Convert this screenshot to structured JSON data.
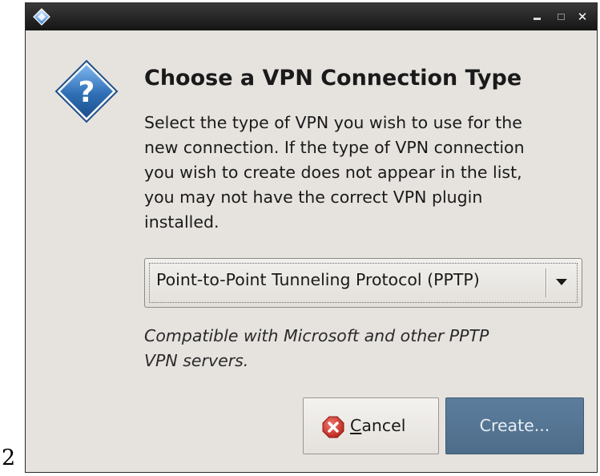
{
  "page": {
    "stray_text": "2"
  },
  "window": {
    "title": "",
    "icon": "diamond-app-icon",
    "controls": {
      "minimize_icon": "minimize-icon",
      "maximize_icon": "maximize-icon",
      "close_icon": "close-icon"
    }
  },
  "dialog": {
    "icon": "question-icon",
    "heading": "Choose a VPN Connection Type",
    "description_lines": [
      "Select the type of VPN you wish to use for the",
      "new connection.  If the type of VPN connection",
      "you wish to create does not appear in the list,",
      "you may not have the correct VPN plugin",
      "installed."
    ],
    "vpn_type_select": {
      "selected": "Point-to-Point Tunneling Protocol (PPTP)",
      "arrow_icon": "dropdown-arrow-icon"
    },
    "hint_lines": [
      "Compatible with Microsoft and other PPTP",
      "VPN servers."
    ]
  },
  "buttons": {
    "cancel": {
      "mnemonic": "C",
      "rest": "ancel",
      "icon": "cancel-icon"
    },
    "create": {
      "label": "Create..."
    }
  },
  "colors": {
    "dialog_background": "#e6e3df",
    "titlebar": "#1f1f1f",
    "primary_button": "#56778f",
    "question_icon": "#2f6fb5",
    "cancel_icon": "#d5332a"
  }
}
